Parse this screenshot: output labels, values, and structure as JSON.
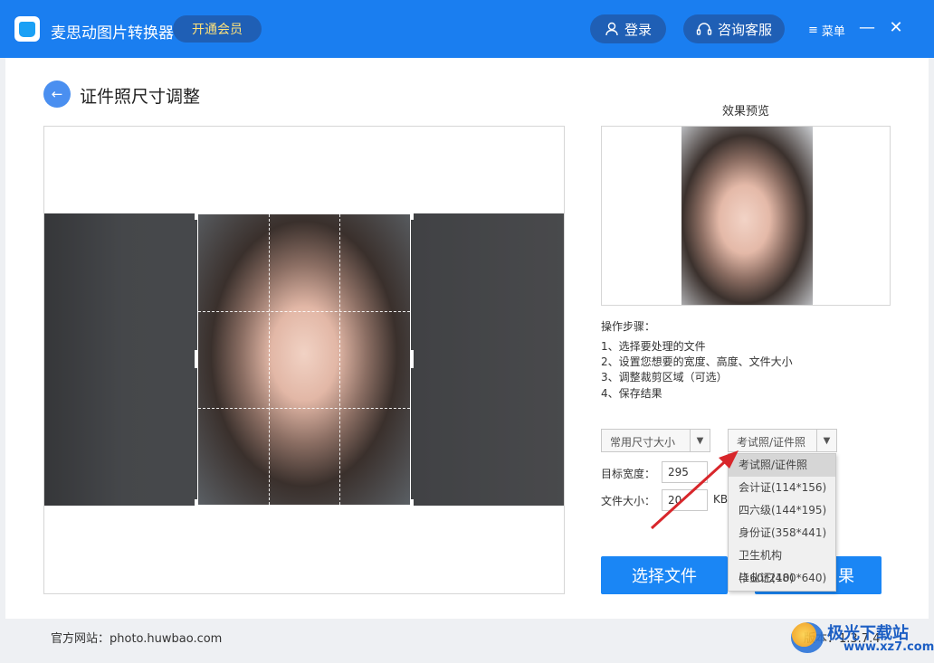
{
  "app": {
    "title": "麦思动图片转换器",
    "vip_label": "开通会员"
  },
  "header": {
    "login_label": "登录",
    "service_label": "咨询客服",
    "menu_label": "菜单",
    "minimize": "—",
    "close": "✕"
  },
  "page": {
    "back_icon": "←",
    "title": "证件照尺寸调整"
  },
  "preview": {
    "caption": "效果预览"
  },
  "steps": {
    "title": "操作步骤：",
    "items": [
      "1、选择要处理的文件",
      "2、设置您想要的宽度、高度、文件大小",
      "3、调整裁剪区域（可选）",
      "4、保存结果"
    ]
  },
  "controls": {
    "size_select_value": "常用尺寸大小",
    "type_select_value": "考试照/证件照",
    "width_label": "目标宽度：",
    "width_value": "295",
    "filesize_label": "文件大小：",
    "filesize_value": "20",
    "filesize_unit": "KB",
    "choose_button": "选择文件",
    "save_button": "果"
  },
  "dropdown": {
    "options": [
      "考试照/证件照",
      "会计证(114*156)",
      "四六级(144*195)",
      "身份证(358*441)",
      "卫生机构(160*210)",
      "毕业证(480*640)"
    ],
    "selected_index": 0
  },
  "footer": {
    "site": "官方网站：photo.huwbao.com",
    "version": "版本：1.3.7.4"
  },
  "watermark": {
    "text": "极光下载站",
    "url": "www.xz7.com"
  },
  "colors": {
    "titlebar": "#1a7ef0",
    "accent": "#1a86f5",
    "vip_text": "#ffe27a",
    "annotation_arrow": "#d8262b"
  }
}
